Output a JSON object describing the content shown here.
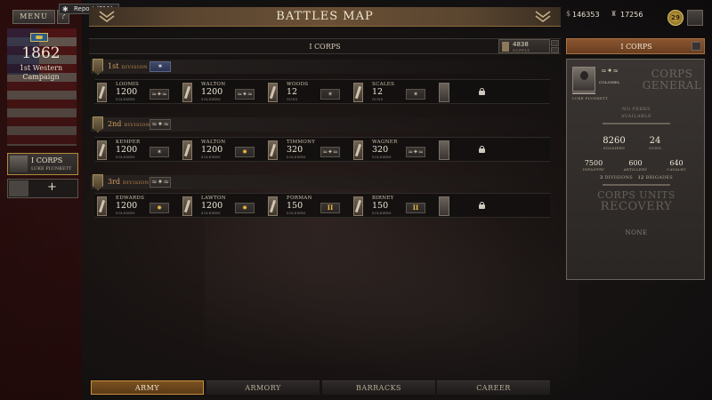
{
  "topbar": {
    "menu_label": "MENU",
    "help_label": "?",
    "report_tooltip": "Report (F11)",
    "title": "BATTLES MAP",
    "money": "146353",
    "currency_symbol": "$",
    "reputation": "17256",
    "rank_level": "29"
  },
  "campaign": {
    "year": "1862",
    "name_line1": "1st Western",
    "name_line2": "Campaign"
  },
  "sidebar": {
    "corps_name": "I CORPS",
    "commander": "LUKE PLUNKETT",
    "add_label": "+"
  },
  "corps_bar": {
    "title": "I CORPS",
    "supply_value": "4838",
    "supply_label": "SUPPLY"
  },
  "divisions": [
    {
      "name": "1st",
      "label": "DIVISION",
      "badge": "✶",
      "brigades": [
        {
          "name": "LOOMIS",
          "value": "1200",
          "unit": "SOLDIERS",
          "badge": "eagle"
        },
        {
          "name": "WALTON",
          "value": "1200",
          "unit": "SOLDIERS",
          "badge": "eagle"
        },
        {
          "name": "WOODS",
          "value": "12",
          "unit": "GUNS",
          "badge": "star"
        },
        {
          "name": "SCALES",
          "value": "12",
          "unit": "GUNS",
          "badge": "star"
        }
      ]
    },
    {
      "name": "2nd",
      "label": "DIVISION",
      "badge": "eagle",
      "brigades": [
        {
          "name": "KEMPER",
          "value": "1200",
          "unit": "SOLDIERS",
          "badge": "star"
        },
        {
          "name": "WALTON",
          "value": "1200",
          "unit": "SOLDIERS",
          "badge": "gold-star"
        },
        {
          "name": "TIMMONY",
          "value": "320",
          "unit": "SOLDIERS",
          "badge": "eagle"
        },
        {
          "name": "WAGNER",
          "value": "320",
          "unit": "SOLDIERS",
          "badge": "eagle"
        }
      ]
    },
    {
      "name": "3rd",
      "label": "DIVISION",
      "badge": "eagle",
      "brigades": [
        {
          "name": "EDWARDS",
          "value": "1200",
          "unit": "SOLDIERS",
          "badge": "gold-star"
        },
        {
          "name": "LAWTON",
          "value": "1200",
          "unit": "SOLDIERS",
          "badge": "gold-star"
        },
        {
          "name": "FORMAN",
          "value": "150",
          "unit": "SOLDIERS",
          "badge": "bars"
        },
        {
          "name": "BIRNEY",
          "value": "150",
          "unit": "SOLDIERS",
          "badge": "bars"
        }
      ]
    }
  ],
  "right_panel": {
    "header": "I CORPS",
    "rank": "COLONEL",
    "commander": "LUKE PLUNKETT",
    "role_line1": "CORPS",
    "role_line2": "GENERAL",
    "perks_line1": "NO PERKS",
    "perks_line2": "AVAILABLE",
    "soldiers_value": "8260",
    "soldiers_label": "SOLDIERS",
    "guns_value": "24",
    "guns_label": "GUNS",
    "infantry_value": "7500",
    "infantry_label": "INFANTRY",
    "artillery_value": "600",
    "artillery_label": "ARTILLERY",
    "cavalry_value": "640",
    "cavalry_label": "CAVALRY",
    "divisions_count": "3",
    "divisions_label": "DIVISIONS",
    "brigades_count": "12",
    "brigades_label": "BRIGADES",
    "recovery_line1": "CORPS UNITS",
    "recovery_line2": "RECOVERY",
    "recovery_value": "NONE"
  },
  "tabs": [
    "ARMY",
    "ARMORY",
    "BARRACKS",
    "CAREER"
  ],
  "active_tab": "ARMY",
  "icons": {
    "star": "✶",
    "gold-star": "✹",
    "bars": "II",
    "eagle": "≈✦≈"
  },
  "colors": {
    "accent_gold": "#c8903a",
    "division_text": "#d8a060"
  }
}
